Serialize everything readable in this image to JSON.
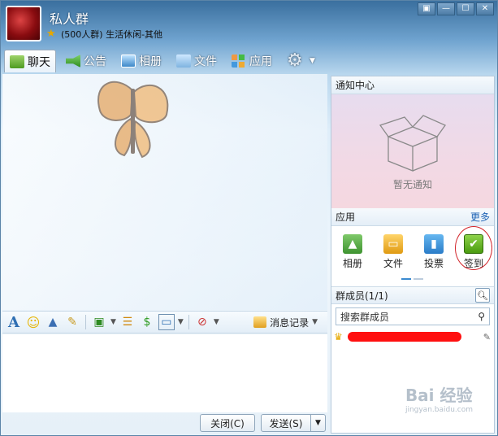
{
  "header": {
    "group_name": "私人群",
    "subtitle": "(500人群) 生活休闲-其他",
    "window_controls": [
      "▣",
      "—",
      "☐",
      "✕"
    ]
  },
  "tabs": [
    {
      "label": "聊天",
      "icon": "chat-icon",
      "active": true
    },
    {
      "label": "公告",
      "icon": "announcement-icon",
      "active": false
    },
    {
      "label": "相册",
      "icon": "album-icon",
      "active": false
    },
    {
      "label": "文件",
      "icon": "folder-icon",
      "active": false
    },
    {
      "label": "应用",
      "icon": "apps-icon",
      "active": false
    }
  ],
  "toolbar": {
    "history_label": "消息记录"
  },
  "buttons": {
    "close_label": "关闭(C)",
    "send_label": "发送(S)"
  },
  "notice_center": {
    "title": "通知中心",
    "empty_text": "暂无通知"
  },
  "apps_panel": {
    "title": "应用",
    "more_label": "更多",
    "items": [
      {
        "label": "相册",
        "icon": "album-icon"
      },
      {
        "label": "文件",
        "icon": "folder-icon"
      },
      {
        "label": "投票",
        "icon": "vote-icon"
      },
      {
        "label": "签到",
        "icon": "checkin-icon"
      }
    ]
  },
  "members": {
    "title": "群成员(1/1)",
    "search_placeholder": "搜索群成员"
  },
  "watermark": {
    "text": "Bai 经验",
    "sub": "jingyan.baidu.com"
  },
  "colors": {
    "accent": "#1e63b5",
    "highlight_ring": "#d2242a"
  }
}
